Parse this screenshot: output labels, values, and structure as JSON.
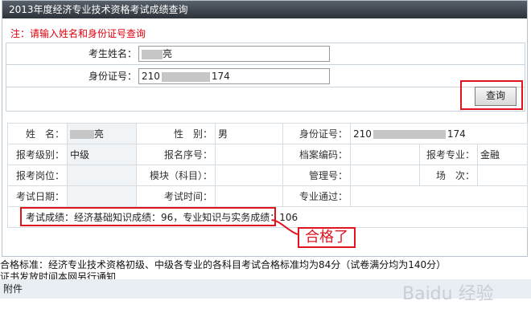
{
  "window": {
    "title": "2013年度经济专业技术资格考试成绩查询"
  },
  "notice": "注：请输入姓名和身份证号查询",
  "form": {
    "name_label": "考生姓名：",
    "name_value_suffix": "亮",
    "id_label": "身份证号：",
    "id_prefix": "210",
    "id_suffix": "174",
    "query_button": "查询"
  },
  "result": {
    "name_label": "姓　名：",
    "name_value_suffix": "亮",
    "gender_label": "性　别：",
    "gender_value": "男",
    "id_label": "身份证号：",
    "id_prefix": "210",
    "id_suffix": "174",
    "level_label": "报考级别：",
    "level_value": "中级",
    "seq_label": "报名序号：",
    "seq_value": "",
    "archive_label": "档案编码：",
    "archive_value": "",
    "major_label": "报考专业：",
    "major_value": "金融",
    "post_label": "报考岗位：",
    "post_value": "",
    "module_label": "模块（科目）：",
    "module_value": "",
    "mgmt_label": "管理号：",
    "mgmt_value": "",
    "session_label": "场　次：",
    "session_value": "",
    "date_label": "考试日期：",
    "date_value": "",
    "time_label": "考试时间：",
    "time_value": "",
    "pass_label": "专业通过：",
    "pass_value": "",
    "score_text": "考试成绩：经济基础知识成绩：96，专业知识与实务成绩：106"
  },
  "annotation": {
    "passed": "合格了"
  },
  "footer": {
    "standard": "合格标准：经济专业技术资格初级、中级各专业的各科目考试合格标准均为84分（试卷满分均为140分）",
    "certificate": "证书发放时间本网另行通知",
    "attachment": "附件"
  },
  "watermark": "Baidu 经验"
}
